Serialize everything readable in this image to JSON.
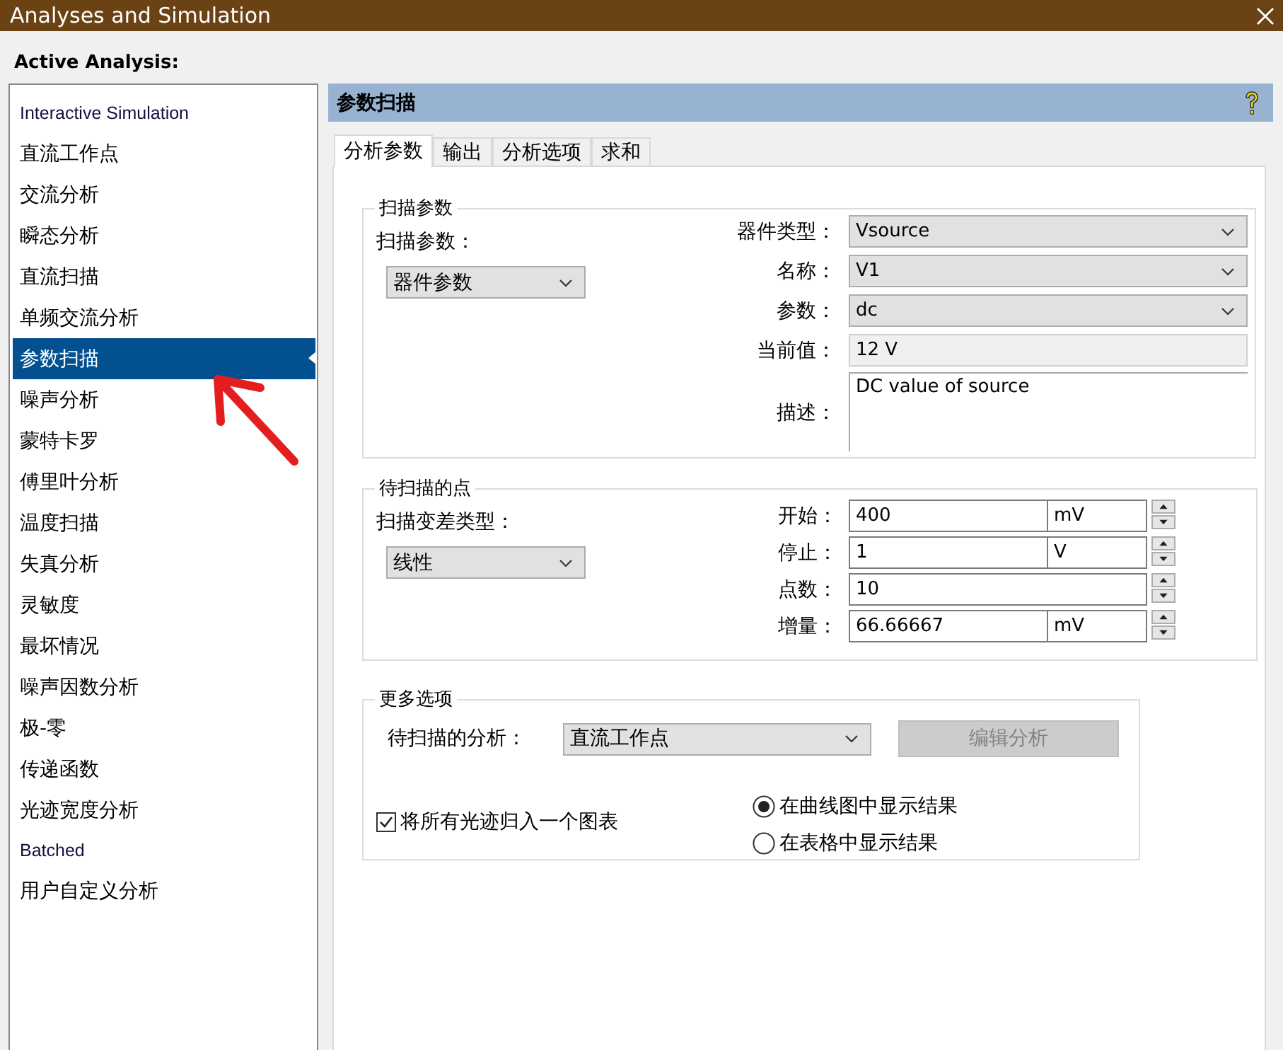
{
  "window": {
    "title": "Analyses and Simulation"
  },
  "active_analysis_label": "Active Analysis:",
  "analyses": [
    {
      "label": "Interactive Simulation",
      "kind": "heading",
      "selected": false
    },
    {
      "label": "直流工作点",
      "kind": "item",
      "selected": false
    },
    {
      "label": "交流分析",
      "kind": "item",
      "selected": false
    },
    {
      "label": "瞬态分析",
      "kind": "item",
      "selected": false
    },
    {
      "label": "直流扫描",
      "kind": "item",
      "selected": false
    },
    {
      "label": "单频交流分析",
      "kind": "item",
      "selected": false
    },
    {
      "label": "参数扫描",
      "kind": "item",
      "selected": true
    },
    {
      "label": "噪声分析",
      "kind": "item",
      "selected": false
    },
    {
      "label": "蒙特卡罗",
      "kind": "item",
      "selected": false
    },
    {
      "label": "傅里叶分析",
      "kind": "item",
      "selected": false
    },
    {
      "label": "温度扫描",
      "kind": "item",
      "selected": false
    },
    {
      "label": "失真分析",
      "kind": "item",
      "selected": false
    },
    {
      "label": "灵敏度",
      "kind": "item",
      "selected": false
    },
    {
      "label": "最坏情况",
      "kind": "item",
      "selected": false
    },
    {
      "label": "噪声因数分析",
      "kind": "item",
      "selected": false
    },
    {
      "label": "极-零",
      "kind": "item",
      "selected": false
    },
    {
      "label": "传递函数",
      "kind": "item",
      "selected": false
    },
    {
      "label": "光迹宽度分析",
      "kind": "item",
      "selected": false
    },
    {
      "label": "Batched",
      "kind": "heading",
      "selected": false
    },
    {
      "label": "用户自定义分析",
      "kind": "item",
      "selected": false
    }
  ],
  "panel": {
    "title": "参数扫描",
    "tabs": [
      {
        "label": "分析参数",
        "selected": true
      },
      {
        "label": "输出",
        "selected": false
      },
      {
        "label": "分析选项",
        "selected": false
      },
      {
        "label": "求和",
        "selected": false
      }
    ],
    "sweep_parameters": {
      "legend": "扫描参数",
      "type_label": "扫描参数：",
      "type_value": "器件参数",
      "fields": [
        {
          "label": "器件类型：",
          "value": "Vsource",
          "kind": "dropdown"
        },
        {
          "label": "名称：",
          "value": "V1",
          "kind": "dropdown"
        },
        {
          "label": "参数：",
          "value": "dc",
          "kind": "dropdown"
        },
        {
          "label": "当前值：",
          "value": "12 V",
          "kind": "readonly"
        },
        {
          "label": "描述：",
          "value": "DC value of source",
          "kind": "textarea"
        }
      ]
    },
    "points": {
      "legend": "待扫描的点",
      "scale_label": "扫描变差类型：",
      "scale_value": "线性",
      "rows": [
        {
          "label": "开始：",
          "value": "400",
          "unit": "mV"
        },
        {
          "label": "停止：",
          "value": "1",
          "unit": "V"
        },
        {
          "label": "点数：",
          "value": "10"
        },
        {
          "label": "增量：",
          "value": "66.66667",
          "unit": "mV"
        }
      ]
    },
    "more_options": {
      "legend": "更多选项",
      "analysis_label": "待扫描的分析：",
      "analysis_value": "直流工作点",
      "edit_button": {
        "label": "编辑分析",
        "disabled": true
      },
      "group_traces": {
        "label": "将所有光迹归入一个图表",
        "checked": true
      },
      "output": [
        {
          "label": "在曲线图中显示结果",
          "selected": true
        },
        {
          "label": "在表格中显示结果",
          "selected": false
        }
      ]
    }
  }
}
